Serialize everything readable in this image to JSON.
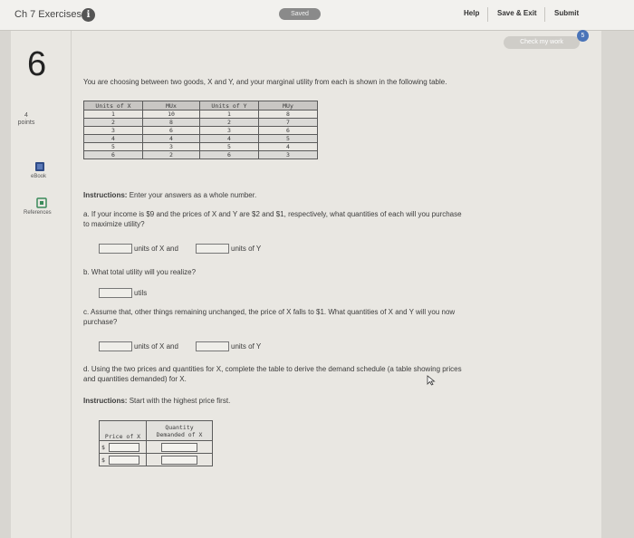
{
  "header": {
    "title": "Ch 7 Exercises",
    "info_glyph": "i",
    "saved": "Saved",
    "help": "Help",
    "save_exit": "Save & Exit",
    "submit": "Submit"
  },
  "check_work": {
    "label": "Check my work",
    "badge": "5"
  },
  "sidebar": {
    "question_number": "6",
    "points_value": "4",
    "points_label": "points",
    "ebook_label": "eBook",
    "references_label": "References"
  },
  "question": {
    "intro": "You are choosing between two goods, X and Y, and your marginal utility from each is shown in the following table.",
    "table": {
      "headers": [
        "Units of X",
        "MUx",
        "Units of Y",
        "MUy"
      ],
      "rows": [
        [
          "1",
          "10",
          "1",
          "8"
        ],
        [
          "2",
          "8",
          "2",
          "7"
        ],
        [
          "3",
          "6",
          "3",
          "6"
        ],
        [
          "4",
          "4",
          "4",
          "5"
        ],
        [
          "5",
          "3",
          "5",
          "4"
        ],
        [
          "6",
          "2",
          "6",
          "3"
        ]
      ]
    },
    "instructions_label": "Instructions:",
    "instructions_text": "Enter your answers as a whole number.",
    "part_a_line1": "a. If your income is $9 and the prices of X and Y are $2 and $1, respectively, what quantities of each will you purchase",
    "part_a_line2": "to maximize utility?",
    "units_of_x": "units of X and",
    "units_of_y": "units of Y",
    "part_b": "b. What total utility will you realize?",
    "utils": "utils",
    "part_c_line1": "c. Assume that, other things remaining unchanged, the price of X falls to $1. What quantities of X and Y will you now",
    "part_c_line2": "purchase?",
    "units_of_x_c": "units of X and",
    "units_of_y_c": "units of Y",
    "part_d_line1": "d. Using the two prices and quantities for X, complete the table to derive the demand schedule (a table showing prices",
    "part_d_line2": "and quantities demanded) for X.",
    "instructions2_label": "Instructions:",
    "instructions2_text": "Start with the highest price first.",
    "demand_table": {
      "col1": "Price of X",
      "col2_line1": "Quantity",
      "col2_line2": "Demanded of X",
      "currency": "$"
    }
  },
  "colors": {
    "accent": "#4a74b8",
    "background": "#e9e7e2"
  }
}
